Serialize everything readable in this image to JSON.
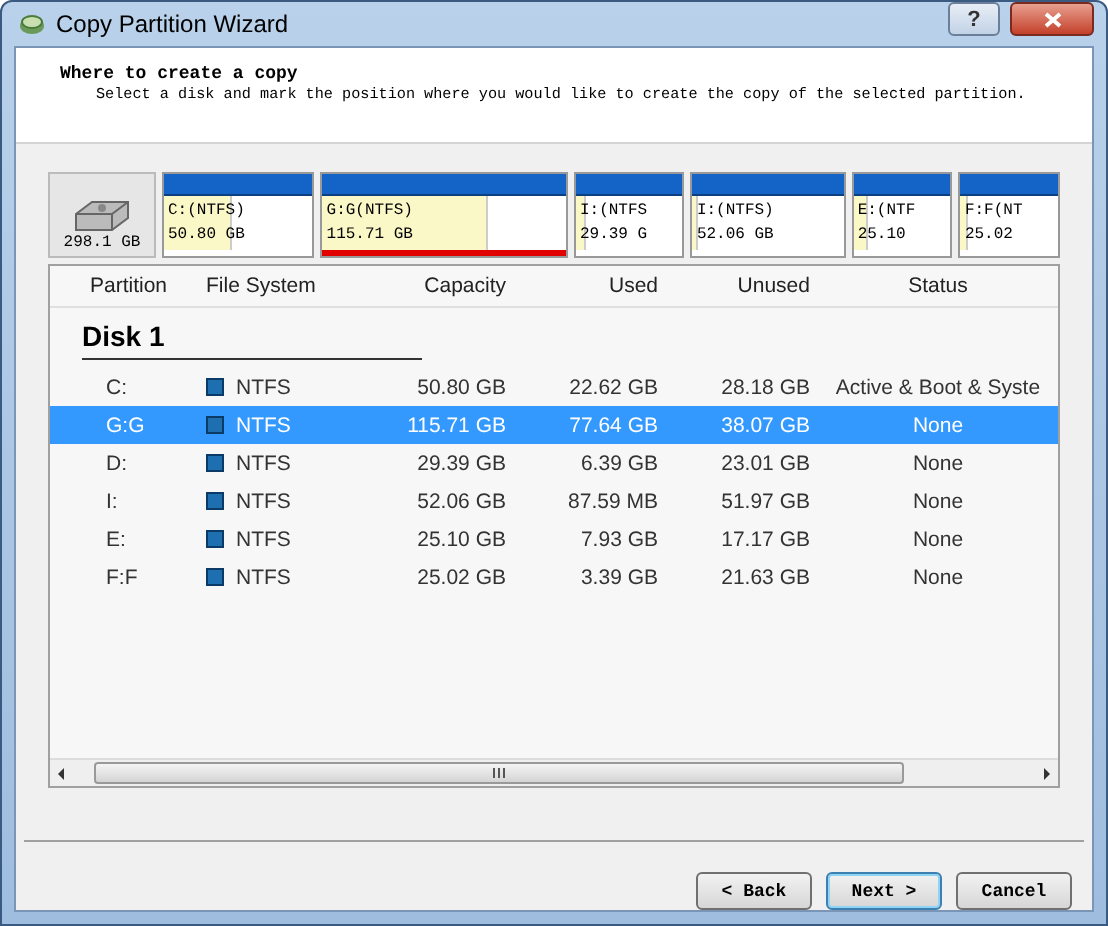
{
  "window": {
    "title": "Copy Partition Wizard",
    "help": "?"
  },
  "header": {
    "title": "Where to create a copy",
    "description": "Select a disk and mark the position where you would like to create the copy of the selected partition."
  },
  "disk_map": {
    "disk_size": "298.1 GB",
    "partitions": [
      {
        "label": "C:(NTFS)",
        "size": "50.80 GB",
        "level": 0.45,
        "selected": false
      },
      {
        "label": "G:G(NTFS)",
        "size": "115.71 GB",
        "level": 0.67,
        "selected": true
      },
      {
        "label": "I:(NTFS",
        "size": "29.39 G",
        "level": 0.08,
        "selected": false
      },
      {
        "label": "I:(NTFS)",
        "size": "52.06 GB",
        "level": 0.02,
        "selected": false
      },
      {
        "label": "E:(NTF",
        "size": "25.10",
        "level": 0.12,
        "selected": false
      },
      {
        "label": "F:F(NT",
        "size": "25.02",
        "level": 0.05,
        "selected": false
      }
    ]
  },
  "table": {
    "columns": [
      "Partition",
      "File System",
      "Capacity",
      "Used",
      "Unused",
      "Status"
    ],
    "group": "Disk 1",
    "rows": [
      {
        "partition": "C:",
        "file_system": "NTFS",
        "capacity": "50.80 GB",
        "used": "22.62 GB",
        "unused": "28.18 GB",
        "status": "Active & Boot & Syste",
        "selected": false
      },
      {
        "partition": "G:G",
        "file_system": "NTFS",
        "capacity": "115.71 GB",
        "used": "77.64 GB",
        "unused": "38.07 GB",
        "status": "None",
        "selected": true
      },
      {
        "partition": "D:",
        "file_system": "NTFS",
        "capacity": "29.39 GB",
        "used": "6.39 GB",
        "unused": "23.01 GB",
        "status": "None",
        "selected": false
      },
      {
        "partition": "I:",
        "file_system": "NTFS",
        "capacity": "52.06 GB",
        "used": "87.59 MB",
        "unused": "51.97 GB",
        "status": "None",
        "selected": false
      },
      {
        "partition": "E:",
        "file_system": "NTFS",
        "capacity": "25.10 GB",
        "used": "7.93 GB",
        "unused": "17.17 GB",
        "status": "None",
        "selected": false
      },
      {
        "partition": "F:F",
        "file_system": "NTFS",
        "capacity": "25.02 GB",
        "used": "3.39 GB",
        "unused": "21.63 GB",
        "status": "None",
        "selected": false
      }
    ]
  },
  "buttons": [
    {
      "label": "< Back",
      "focused": false
    },
    {
      "label": "Next >",
      "focused": true
    },
    {
      "label": "Cancel",
      "focused": false
    }
  ]
}
